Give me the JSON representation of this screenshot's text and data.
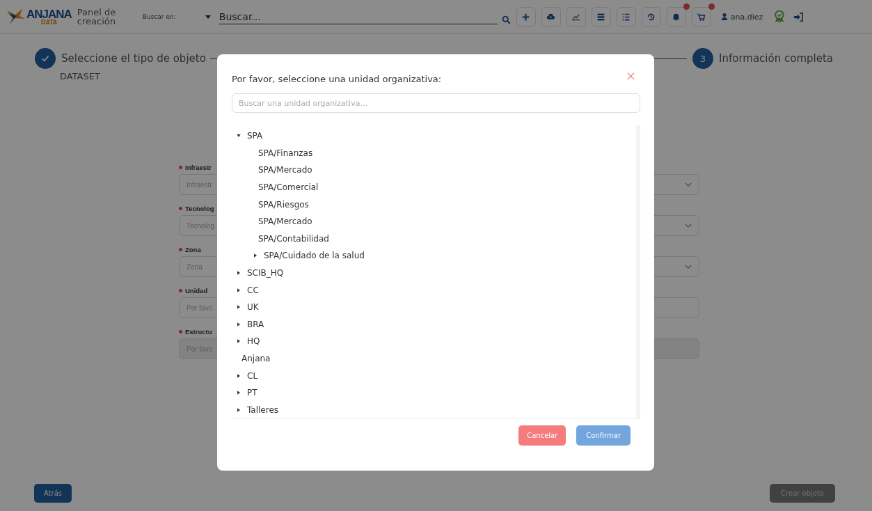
{
  "header": {
    "logo": {
      "name": "ANJANA",
      "sub": "DATA"
    },
    "title": "Panel de creación",
    "search_scope": "Buscar en:",
    "search": {
      "placeholder": "Buscar..."
    },
    "tools": [
      {
        "kind": "plus",
        "badge": false
      },
      {
        "kind": "cloud",
        "badge": false
      },
      {
        "kind": "chart",
        "badge": false
      },
      {
        "kind": "table",
        "badge": false
      },
      {
        "kind": "list",
        "badge": false
      },
      {
        "kind": "history",
        "badge": false
      },
      {
        "kind": "bell",
        "badge": true
      },
      {
        "kind": "cart",
        "badge": true
      }
    ],
    "user": "ana.diez"
  },
  "steps": [
    {
      "kind": "done",
      "label": "Seleccione el tipo de objeto",
      "value": "DATASET"
    },
    {
      "kind": "number",
      "number": "3",
      "label": "Información completa"
    }
  ],
  "form": [
    {
      "label": "Infraestr",
      "placeholder": "Infraestr",
      "kind": "select",
      "disabled": false
    },
    {
      "label": "Tecnolog",
      "placeholder": "Tecnolog",
      "kind": "select",
      "disabled": false
    },
    {
      "label": "Zona",
      "placeholder": "Zona",
      "kind": "select",
      "disabled": false
    },
    {
      "label": "Unidad",
      "placeholder": "Por favo",
      "kind": "text",
      "disabled": false
    },
    {
      "label": "Estructu",
      "placeholder": "Por favo",
      "kind": "text",
      "disabled": true
    }
  ],
  "modal": {
    "title": "Por favor, seleccione una unidad organizativa:",
    "search": {
      "placeholder": "Buscar una unidad organizativa..."
    },
    "tree": [
      {
        "label": "SPA",
        "kind": "branch",
        "expanded": true,
        "children": [
          {
            "label": "SPA/Finanzas",
            "kind": "leaf"
          },
          {
            "label": "SPA/Mercado",
            "kind": "leaf"
          },
          {
            "label": "SPA/Comercial",
            "kind": "leaf"
          },
          {
            "label": "SPA/Riesgos",
            "kind": "leaf"
          },
          {
            "label": "SPA/Mercado",
            "kind": "leaf"
          },
          {
            "label": "SPA/Contabilidad",
            "kind": "leaf"
          },
          {
            "label": "SPA/Cuidado de la salud",
            "kind": "branch",
            "expanded": false
          }
        ]
      },
      {
        "label": "SCIB_HQ",
        "kind": "branch",
        "expanded": false
      },
      {
        "label": "CC",
        "kind": "branch",
        "expanded": false
      },
      {
        "label": "UK",
        "kind": "branch",
        "expanded": false
      },
      {
        "label": "BRA",
        "kind": "branch",
        "expanded": false
      },
      {
        "label": "HQ",
        "kind": "branch",
        "expanded": false
      },
      {
        "label": "Anjana",
        "kind": "leaf"
      },
      {
        "label": "CL",
        "kind": "branch",
        "expanded": false
      },
      {
        "label": "PT",
        "kind": "branch",
        "expanded": false
      },
      {
        "label": "Talleres",
        "kind": "branch",
        "expanded": false
      }
    ],
    "buttons": [
      {
        "label": "Cancelar",
        "kind": "cancel"
      },
      {
        "label": "Confirmar",
        "kind": "confirm"
      }
    ]
  },
  "footer": {
    "back": "Atrás",
    "create": {
      "label": "Crear objeto",
      "disabled": true
    }
  }
}
